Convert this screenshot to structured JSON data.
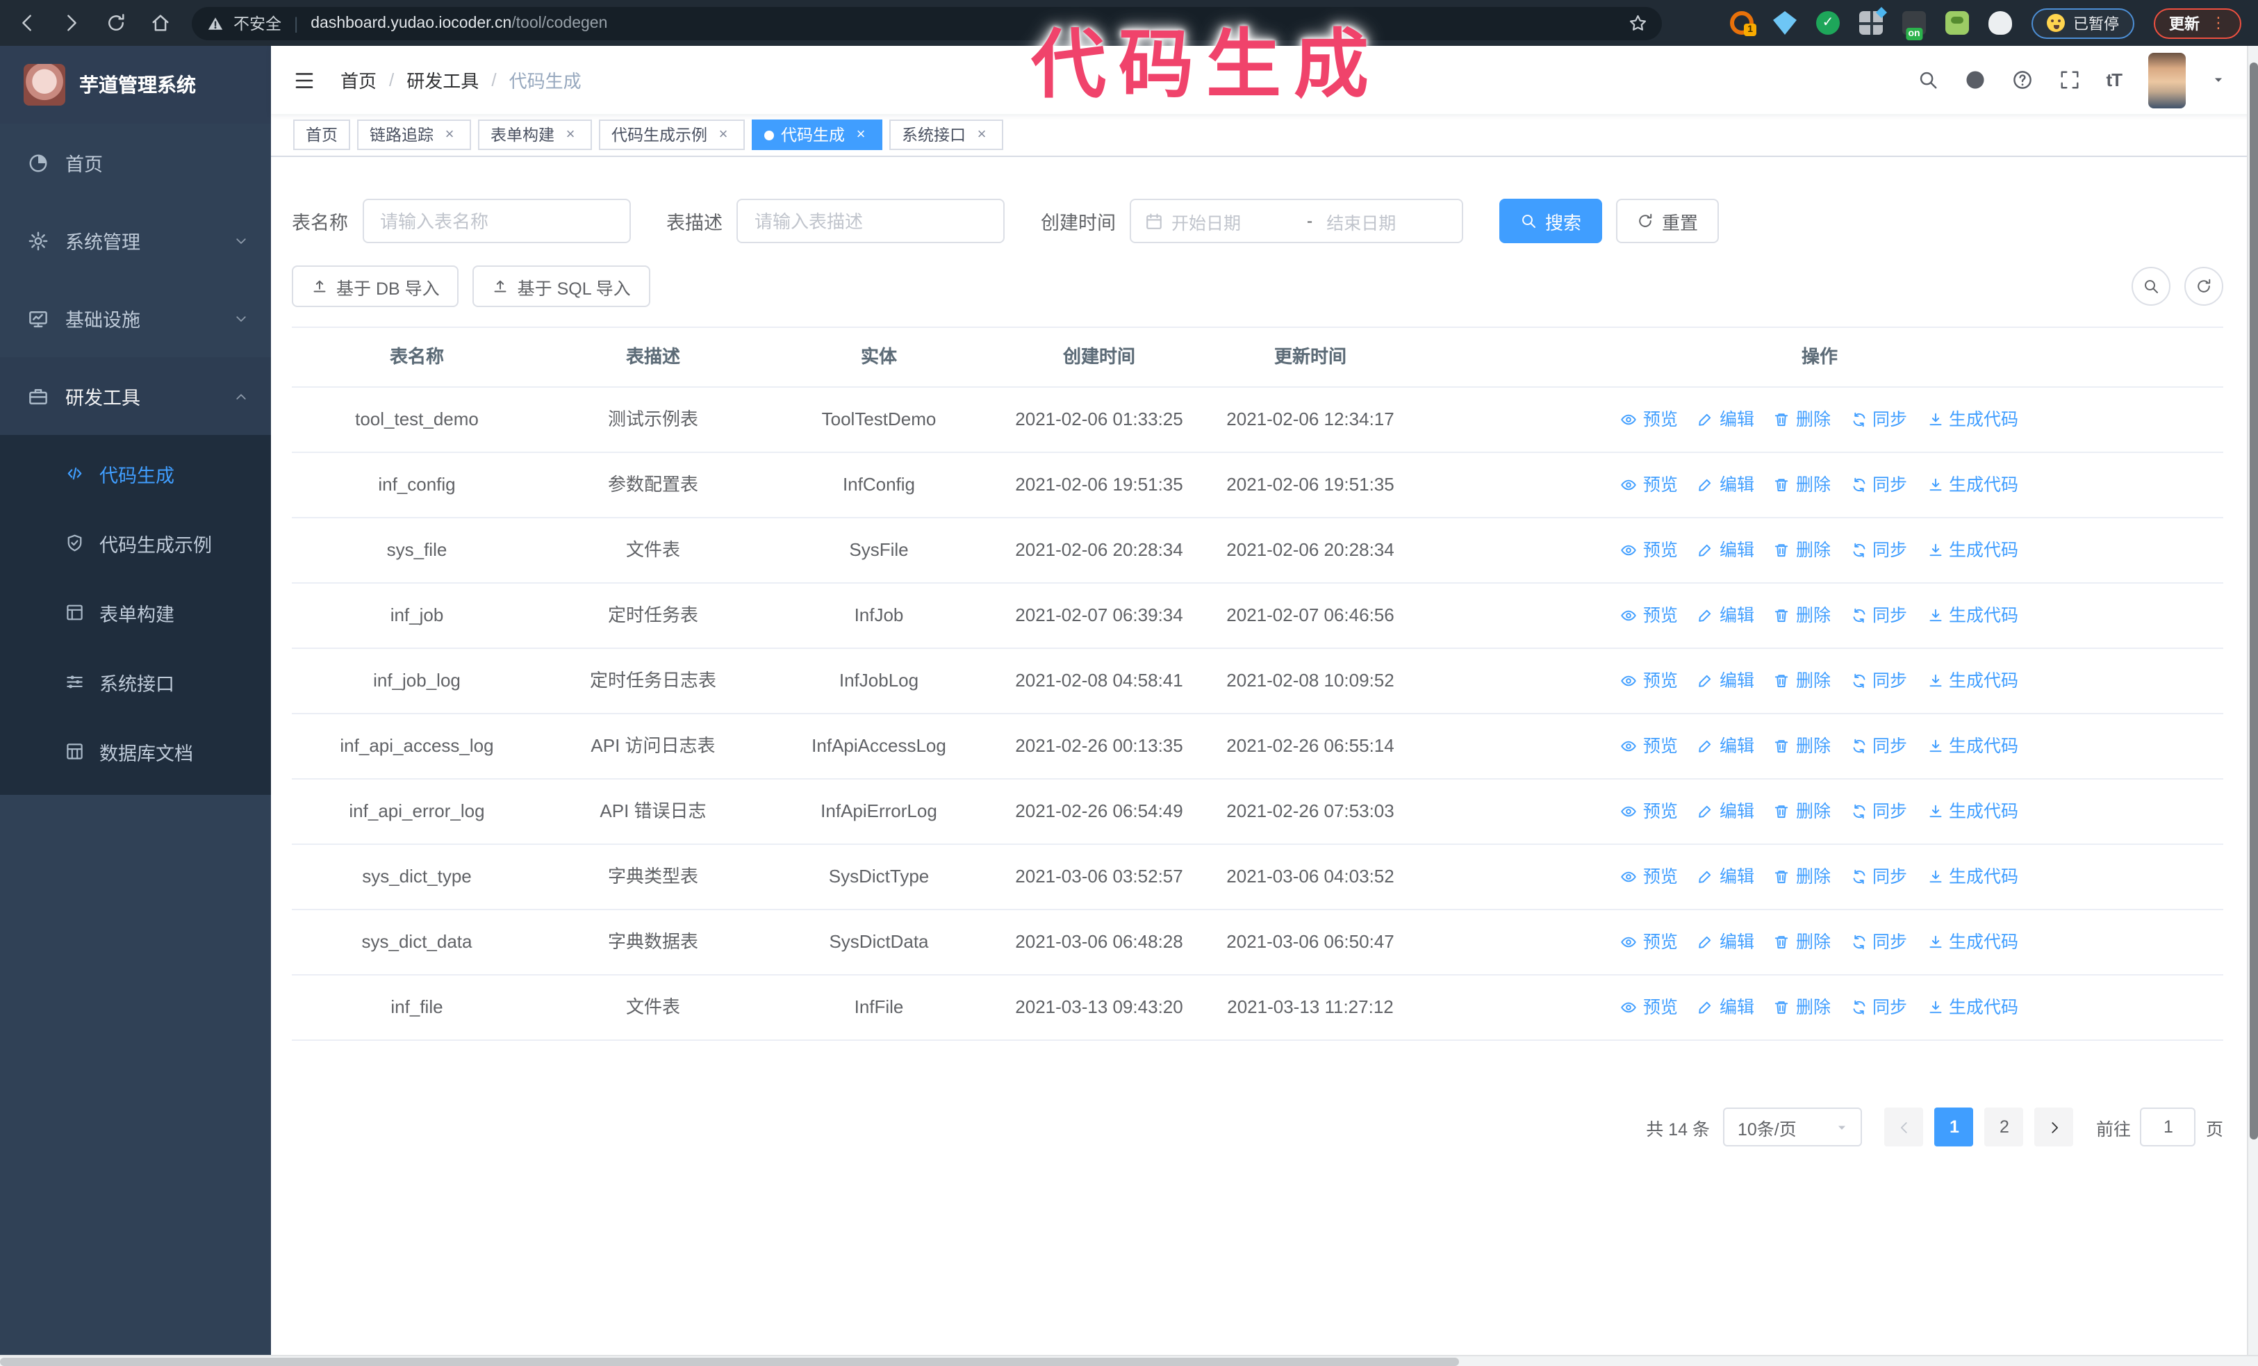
{
  "annotation": {
    "text": "代码生成",
    "color": "#f0436b"
  },
  "browser": {
    "security_label": "不安全",
    "url_host": "dashboard.yudao.iocoder.cn",
    "url_path": "/tool/codegen",
    "extension_badge_count": "1",
    "extension_badge_on": "on",
    "paused_badge": "已暂停",
    "update_button": "更新"
  },
  "sidebar": {
    "title": "芋道管理系统",
    "items": [
      {
        "label": "首页",
        "icon": "pie-icon",
        "expanded": false
      },
      {
        "label": "系统管理",
        "icon": "gear-icon",
        "expanded": false
      },
      {
        "label": "基础设施",
        "icon": "monitor-icon",
        "expanded": false
      },
      {
        "label": "研发工具",
        "icon": "briefcase-icon",
        "expanded": true
      }
    ],
    "submenu": [
      {
        "label": "代码生成",
        "icon": "code-icon",
        "active": true
      },
      {
        "label": "代码生成示例",
        "icon": "shield-check-icon",
        "active": false
      },
      {
        "label": "表单构建",
        "icon": "form-icon",
        "active": false
      },
      {
        "label": "系统接口",
        "icon": "sliders-icon",
        "active": false
      },
      {
        "label": "数据库文档",
        "icon": "table-doc-icon",
        "active": false
      }
    ]
  },
  "navbar": {
    "breadcrumb": [
      "首页",
      "研发工具",
      "代码生成"
    ],
    "separator": "/"
  },
  "tabs": [
    {
      "label": "首页",
      "closable": false,
      "active": false
    },
    {
      "label": "链路追踪",
      "closable": true,
      "active": false
    },
    {
      "label": "表单构建",
      "closable": true,
      "active": false
    },
    {
      "label": "代码生成示例",
      "closable": true,
      "active": false
    },
    {
      "label": "代码生成",
      "closable": true,
      "active": true
    },
    {
      "label": "系统接口",
      "closable": true,
      "active": false
    }
  ],
  "search": {
    "name_label": "表名称",
    "name_placeholder": "请输入表名称",
    "desc_label": "表描述",
    "desc_placeholder": "请输入表描述",
    "time_label": "创建时间",
    "start_placeholder": "开始日期",
    "range_separator": "-",
    "end_placeholder": "结束日期",
    "search_button": "搜索",
    "reset_button": "重置"
  },
  "toolbar": {
    "db_import_button": "基于 DB 导入",
    "sql_import_button": "基于 SQL 导入"
  },
  "table": {
    "columns": [
      "表名称",
      "表描述",
      "实体",
      "创建时间",
      "更新时间",
      "操作"
    ],
    "actions": [
      "预览",
      "编辑",
      "删除",
      "同步",
      "生成代码"
    ],
    "rows": [
      {
        "name": "tool_test_demo",
        "desc": "测试示例表",
        "entity": "ToolTestDemo",
        "created": "2021-02-06 01:33:25",
        "updated": "2021-02-06 12:34:17"
      },
      {
        "name": "inf_config",
        "desc": "参数配置表",
        "entity": "InfConfig",
        "created": "2021-02-06 19:51:35",
        "updated": "2021-02-06 19:51:35"
      },
      {
        "name": "sys_file",
        "desc": "文件表",
        "entity": "SysFile",
        "created": "2021-02-06 20:28:34",
        "updated": "2021-02-06 20:28:34"
      },
      {
        "name": "inf_job",
        "desc": "定时任务表",
        "entity": "InfJob",
        "created": "2021-02-07 06:39:34",
        "updated": "2021-02-07 06:46:56"
      },
      {
        "name": "inf_job_log",
        "desc": "定时任务日志表",
        "entity": "InfJobLog",
        "created": "2021-02-08 04:58:41",
        "updated": "2021-02-08 10:09:52"
      },
      {
        "name": "inf_api_access_log",
        "desc": "API 访问日志表",
        "entity": "InfApiAccessLog",
        "created": "2021-02-26 00:13:35",
        "updated": "2021-02-26 06:55:14"
      },
      {
        "name": "inf_api_error_log",
        "desc": "API 错误日志",
        "entity": "InfApiErrorLog",
        "created": "2021-02-26 06:54:49",
        "updated": "2021-02-26 07:53:03"
      },
      {
        "name": "sys_dict_type",
        "desc": "字典类型表",
        "entity": "SysDictType",
        "created": "2021-03-06 03:52:57",
        "updated": "2021-03-06 04:03:52"
      },
      {
        "name": "sys_dict_data",
        "desc": "字典数据表",
        "entity": "SysDictData",
        "created": "2021-03-06 06:48:28",
        "updated": "2021-03-06 06:50:47"
      },
      {
        "name": "inf_file",
        "desc": "文件表",
        "entity": "InfFile",
        "created": "2021-03-13 09:43:20",
        "updated": "2021-03-13 11:27:12"
      }
    ]
  },
  "pagination": {
    "total": "共 14 条",
    "page_size": "10条/页",
    "pages": [
      "1",
      "2"
    ],
    "active_page": "1",
    "goto_label": "前往",
    "goto_value": "1",
    "page_suffix": "页"
  },
  "icons": [
    "back-icon",
    "forward-icon",
    "reload-icon",
    "home-icon",
    "warning-icon",
    "bookmark-star-icon",
    "extension-icon",
    "paused-face-icon",
    "more-dots-icon",
    "pie-icon",
    "gear-icon",
    "monitor-icon",
    "briefcase-icon",
    "code-icon",
    "shield-check-icon",
    "form-icon",
    "sliders-icon",
    "table-doc-icon",
    "fold-icon",
    "search-icon",
    "github-icon",
    "question-icon",
    "fullscreen-icon",
    "font-size-icon",
    "caret-down-icon",
    "chevron-down-icon",
    "chevron-up-icon",
    "calendar-icon",
    "refresh-icon",
    "upload-icon",
    "eye-icon",
    "pencil-icon",
    "trash-icon",
    "sync-icon",
    "download-icon",
    "close-icon"
  ],
  "colors": {
    "accent": "#409EFF",
    "annotation": "#f0436b",
    "chrome_bg": "#212b35",
    "sidebar_bg": "#304156",
    "submenu_bg": "#1f2d3d",
    "active_tab_bg": "#409EFF"
  }
}
